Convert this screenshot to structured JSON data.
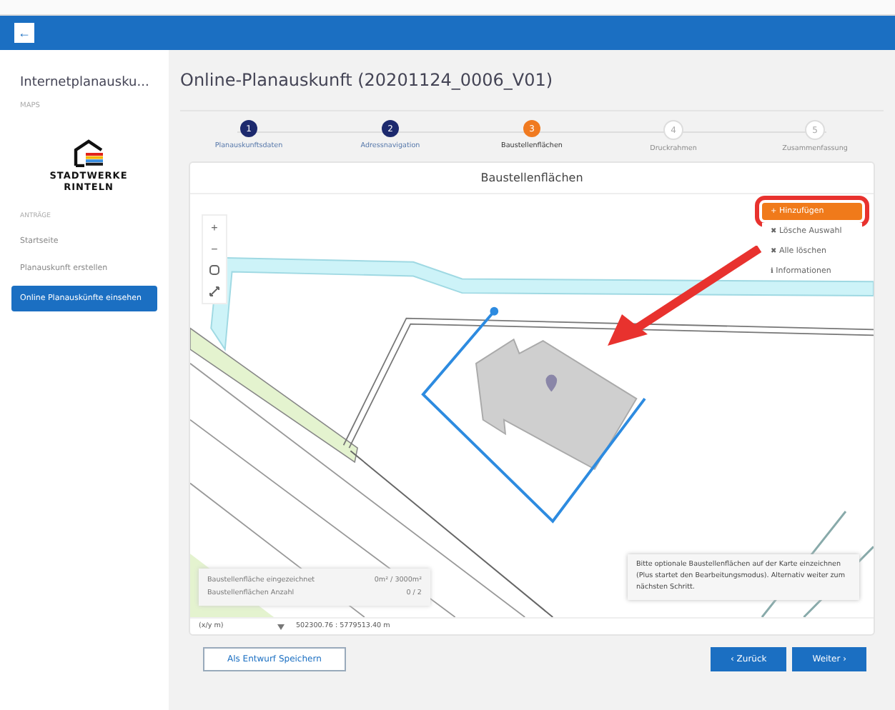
{
  "header": {
    "back_button": "←"
  },
  "sidebar": {
    "app_title": "Internetplanausku...",
    "app_subtitle": "MAPS",
    "logo_text": [
      "STADTWERKE",
      "RINTELN"
    ],
    "section_label": "ANTRÄGE",
    "items": [
      {
        "label": "Startseite",
        "selected": false
      },
      {
        "label": "Planauskunft erstellen",
        "selected": false
      },
      {
        "label": "Online Planauskünfte einsehen",
        "selected": true
      }
    ]
  },
  "page_title": "Online-Planauskunft (20201124_0006_V01)",
  "steps": [
    {
      "number": "1",
      "label": "Planauskunftsdaten",
      "completed": true,
      "selected": false
    },
    {
      "number": "2",
      "label": "Adressnavigation",
      "completed": true,
      "selected": false
    },
    {
      "number": "3",
      "label": "Baustellenflächen",
      "completed": false,
      "selected": true
    },
    {
      "number": "4",
      "label": "Druckrahmen",
      "completed": false,
      "selected": false
    },
    {
      "number": "5",
      "label": "Zusammenfassung",
      "completed": false,
      "selected": false
    }
  ],
  "card_title": "Baustellenflächen",
  "map": {
    "zoom_controls": [
      "+",
      "−"
    ],
    "tools": [
      {
        "label": "Hinzufügen",
        "icon": "+",
        "kind": "primary",
        "highlighted": true
      },
      {
        "label": "Lösche Auswahl",
        "icon": "✖",
        "kind": "plain",
        "highlighted": false
      },
      {
        "label": "Alle löschen",
        "icon": "✖",
        "kind": "plain",
        "highlighted": false
      },
      {
        "label": "Informationen",
        "icon": "ℹ",
        "kind": "plain",
        "highlighted": false
      }
    ],
    "stats": [
      {
        "label": "Baustellenfläche eingezeichnet",
        "value": "0m² / 3000m²"
      },
      {
        "label": "Baustellenflächen Anzahl",
        "value": "0 / 2"
      }
    ],
    "hint": "Bitte optionale Baustellenflächen auf der Karte einzeichnen (Plus startet den Bearbeitungsmodus). Alternativ weiter zum nächsten Schritt."
  },
  "coordinates": {
    "unit": "(x/y m)",
    "value": "502300.76 : 5779513.40 m"
  },
  "buttons": {
    "draft": "Als Entwurf Speichern",
    "back": "‹ Zurück",
    "next": "Weiter ›"
  }
}
